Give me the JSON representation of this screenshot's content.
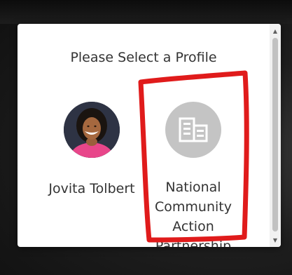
{
  "dialog": {
    "title": "Please Select a Profile",
    "profiles": [
      {
        "name": "Jovita Tolbert",
        "avatar": "person-photo"
      },
      {
        "name": "National Community Action Partnership",
        "avatar": "building-icon"
      }
    ]
  },
  "colors": {
    "annotation": "#e01b1b",
    "org_avatar_bg": "#c4c4c4",
    "text": "#333333"
  },
  "icons": {
    "scroll_up": "▲",
    "scroll_down": "▼"
  }
}
